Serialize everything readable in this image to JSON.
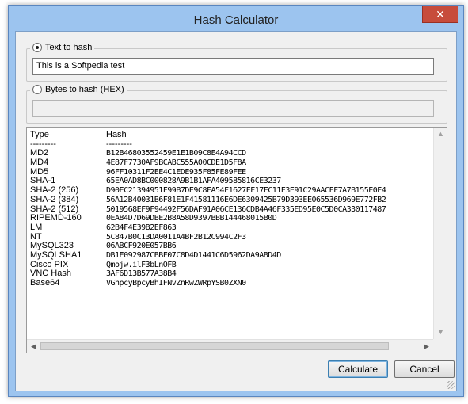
{
  "window": {
    "title": "Hash Calculator",
    "close_glyph": "✕"
  },
  "text_group": {
    "label": "Text to hash",
    "value": "This is a Softpedia test",
    "selected": true
  },
  "bytes_group": {
    "label": "Bytes to hash (HEX)",
    "value": "",
    "selected": false
  },
  "results": {
    "header": {
      "type": "Type",
      "hash": "Hash"
    },
    "separator": {
      "type": "---------",
      "hash": "---------"
    },
    "rows": [
      {
        "type": "MD2",
        "hash": "B12B46803552459E1E1B09C8E4A94CCD"
      },
      {
        "type": "MD4",
        "hash": "4E87F7730AF9BCABC555A00CDE1D5F8A"
      },
      {
        "type": "MD5",
        "hash": "96FF10311F2EE4C1EDE935F85FE89FEE"
      },
      {
        "type": "SHA-1",
        "hash": "65EA0AD8BC000828A9B1B1AFA409585816CE3237"
      },
      {
        "type": "SHA-2 (256)",
        "hash": "D90EC21394951F99B7DE9C8FA54F1627FF17FC11E3E91C29AACFF7A7B155E0E4"
      },
      {
        "type": "SHA-2 (384)",
        "hash": "56A12B40031B6F81E1F41581116E6DE6309425B79D393EE065536D969E772FB2"
      },
      {
        "type": "SHA-2 (512)",
        "hash": "5019568EF9F94492F56DAF91A06CE136CDB4A46F335ED95E0C5D0CA330117487"
      },
      {
        "type": "RIPEMD-160",
        "hash": "0EA84D7D69DBE2B8A58D9397BBB144468015B0D"
      },
      {
        "type": "LM",
        "hash": "62B4F4E39B2EF863"
      },
      {
        "type": "NT",
        "hash": "5C847B0C13DA0011A4BF2B12C994C2F3"
      },
      {
        "type": "MySQL323",
        "hash": "06ABCF920E057BB6"
      },
      {
        "type": "MySQLSHA1",
        "hash": "DB1E092987CBBF07C8D4D1441C6D5962DA9ABD4D"
      },
      {
        "type": "Cisco PIX",
        "hash": "Qmojw.ilF3bLnOFB"
      },
      {
        "type": "VNC Hash",
        "hash": "3AF6D13B577A38B4"
      },
      {
        "type": "Base64",
        "hash": "VGhpcyBpcyBhIFNvZnRwZWRpYSB0ZXN0"
      }
    ]
  },
  "buttons": {
    "calculate": "Calculate",
    "cancel": "Cancel"
  }
}
